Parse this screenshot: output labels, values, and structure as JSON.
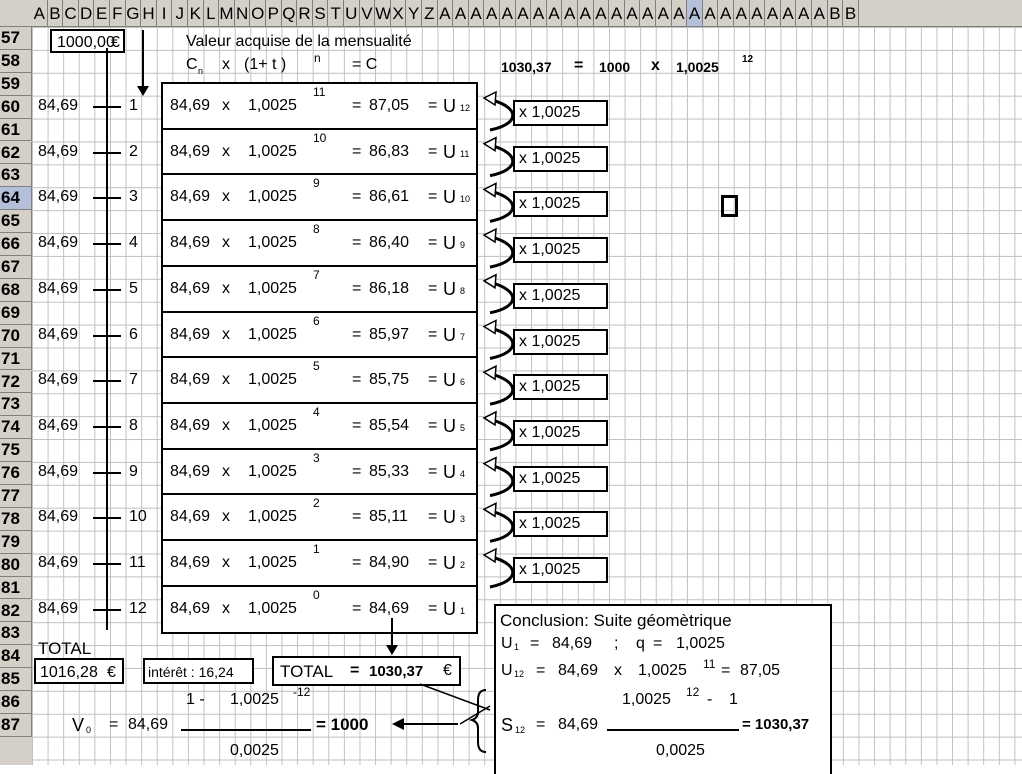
{
  "columns": [
    "A",
    "B",
    "C",
    "D",
    "E",
    "F",
    "G",
    "H",
    "I",
    "J",
    "K",
    "L",
    "M",
    "N",
    "O",
    "P",
    "Q",
    "R",
    "S",
    "T",
    "U",
    "V",
    "W",
    "X",
    "Y",
    "Z",
    "AA",
    "AB",
    "AC",
    "AD",
    "AE",
    "AF",
    "AG",
    "AH",
    "AI",
    "AJ",
    "AK",
    "AL",
    "AM",
    "AN",
    "AO",
    "AP",
    "AQ",
    "AR",
    "AS",
    "AT",
    "AU",
    "AV",
    "AW",
    "AX",
    "AY",
    "AZ",
    "BA"
  ],
  "column_labels": [
    "A",
    "B",
    "C",
    "D",
    "E",
    "F",
    "G",
    "H",
    "I",
    "J",
    "K",
    "L",
    "M",
    "N",
    "O",
    "P",
    "Q",
    "R",
    "S",
    "T",
    "U",
    "V",
    "W",
    "X",
    "Y",
    "Z",
    "A",
    "A",
    "A",
    "A",
    "A",
    "A",
    "A",
    "A",
    "A",
    "A",
    "A",
    "A",
    "A",
    "A",
    "A",
    "A",
    "A",
    "A",
    "A",
    "A",
    "A",
    "A",
    "A",
    "A",
    "A",
    "B",
    "B"
  ],
  "rows": [
    "57",
    "58",
    "59",
    "60",
    "61",
    "62",
    "63",
    "64",
    "65",
    "66",
    "67",
    "68",
    "69",
    "70",
    "71",
    "72",
    "73",
    "74",
    "75",
    "76",
    "77",
    "78",
    "79",
    "80",
    "81",
    "82",
    "83",
    "84",
    "85",
    "86",
    "87"
  ],
  "header": {
    "capital": "1000,00",
    "euro": "€",
    "title": "Valeur acquise de la mensualité",
    "formula": {
      "cn": "C",
      "cn_sub": "n",
      "x": "x",
      "paren": "(1+ t  )",
      "n": "n",
      "eq": "= C"
    },
    "summary": {
      "value": "1030,37",
      "eq": "=",
      "base": "1000",
      "x": "x",
      "rate": "1,0025",
      "exp": "12"
    }
  },
  "months": [
    {
      "payment": "84,69",
      "num": "1",
      "rate": "1,0025",
      "exp": "11",
      "result": "87,05",
      "u": "U",
      "usub": "12"
    },
    {
      "payment": "84,69",
      "num": "2",
      "rate": "1,0025",
      "exp": "10",
      "result": "86,83",
      "u": "U",
      "usub": "11"
    },
    {
      "payment": "84,69",
      "num": "3",
      "rate": "1,0025",
      "exp": "9",
      "result": "86,61",
      "u": "U",
      "usub": "10"
    },
    {
      "payment": "84,69",
      "num": "4",
      "rate": "1,0025",
      "exp": "8",
      "result": "86,40",
      "u": "U",
      "usub": "9"
    },
    {
      "payment": "84,69",
      "num": "5",
      "rate": "1,0025",
      "exp": "7",
      "result": "86,18",
      "u": "U",
      "usub": "8"
    },
    {
      "payment": "84,69",
      "num": "6",
      "rate": "1,0025",
      "exp": "6",
      "result": "85,97",
      "u": "U",
      "usub": "7"
    },
    {
      "payment": "84,69",
      "num": "7",
      "rate": "1,0025",
      "exp": "5",
      "result": "85,75",
      "u": "U",
      "usub": "6"
    },
    {
      "payment": "84,69",
      "num": "8",
      "rate": "1,0025",
      "exp": "4",
      "result": "85,54",
      "u": "U",
      "usub": "5"
    },
    {
      "payment": "84,69",
      "num": "9",
      "rate": "1,0025",
      "exp": "3",
      "result": "85,33",
      "u": "U",
      "usub": "4"
    },
    {
      "payment": "84,69",
      "num": "10",
      "rate": "1,0025",
      "exp": "2",
      "result": "85,11",
      "u": "U",
      "usub": "3"
    },
    {
      "payment": "84,69",
      "num": "11",
      "rate": "1,0025",
      "exp": "1",
      "result": "84,90",
      "u": "U",
      "usub": "2"
    },
    {
      "payment": "84,69",
      "num": "12",
      "rate": "1,0025",
      "exp": "0",
      "result": "84,69",
      "u": "U",
      "usub": "1"
    }
  ],
  "multipliers": [
    "x 1,0025",
    "x 1,0025",
    "x 1,0025",
    "x 1,0025",
    "x 1,0025",
    "x 1,0025",
    "x 1,0025",
    "x 1,0025",
    "x 1,0025",
    "x 1,0025",
    "x 1,0025"
  ],
  "x_sign": "x",
  "eq_sign": "=",
  "totals": {
    "total_label": "TOTAL",
    "total_payments": "1016,28",
    "euro": "€",
    "interest": "intérêt : 16,24",
    "total2_label": "TOTAL",
    "total2_eq": "=",
    "total2_value": "1030,37",
    "total2_euro": "€"
  },
  "v0": {
    "label": "V",
    "sub": "0",
    "eq": "=",
    "payment": "84,69",
    "num_one": "1 -",
    "num_rate": "1,0025",
    "num_exp": "-12",
    "den": "0,0025",
    "result": "= 1000"
  },
  "conclusion": {
    "title": "Conclusion: Suite géomètrique",
    "u1_label": "U",
    "u1_sub": "1",
    "u1_eq": "=",
    "u1_val": "84,69",
    "sep": ";",
    "q_label": "q",
    "q_eq": "=",
    "q_val": "1,0025",
    "u12_label": "U",
    "u12_sub": "12",
    "u12_eq": "=",
    "u12_val": "84,69",
    "u12_x": "x",
    "u12_rate": "1,0025",
    "u12_exp": "11",
    "u12_eq2": "=",
    "u12_res": "87,05",
    "s_label": "S",
    "s_sub": "12",
    "s_eq": "=",
    "s_val": "84,69",
    "s_num_rate": "1,0025",
    "s_num_exp": "12",
    "s_num_minus": "-",
    "s_num_one": "1",
    "s_den": "0,0025",
    "s_res": "= 1030,37"
  }
}
